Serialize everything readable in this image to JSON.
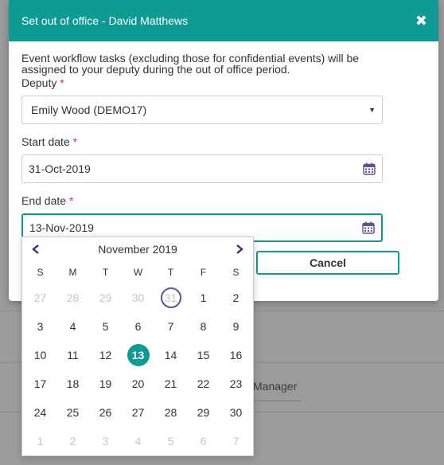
{
  "background": {
    "text": "Manager"
  },
  "modal": {
    "title": "Set out of office - David Matthews",
    "close_glyph": "✖",
    "info": "Event workflow tasks (excluding those for confidential events) will be assigned to your deputy during the out of office period.",
    "deputy": {
      "label": "Deputy",
      "required": "*",
      "value": "Emily Wood (DEMO17)"
    },
    "start": {
      "label": "Start date",
      "required": "*",
      "value": "31-Oct-2019"
    },
    "end": {
      "label": "End date",
      "required": "*",
      "value": "13-Nov-2019"
    },
    "cancel_label": "Cancel"
  },
  "datepicker": {
    "title": "November 2019",
    "dow": [
      "S",
      "M",
      "T",
      "W",
      "T",
      "F",
      "S"
    ],
    "weeks": [
      [
        {
          "d": "27",
          "m": true
        },
        {
          "d": "28",
          "m": true
        },
        {
          "d": "29",
          "m": true
        },
        {
          "d": "30",
          "m": true
        },
        {
          "d": "31",
          "m": true,
          "today": true
        },
        {
          "d": "1"
        },
        {
          "d": "2"
        }
      ],
      [
        {
          "d": "3"
        },
        {
          "d": "4"
        },
        {
          "d": "5"
        },
        {
          "d": "6"
        },
        {
          "d": "7"
        },
        {
          "d": "8"
        },
        {
          "d": "9"
        }
      ],
      [
        {
          "d": "10"
        },
        {
          "d": "11"
        },
        {
          "d": "12"
        },
        {
          "d": "13",
          "selected": true
        },
        {
          "d": "14"
        },
        {
          "d": "15"
        },
        {
          "d": "16"
        }
      ],
      [
        {
          "d": "17"
        },
        {
          "d": "18"
        },
        {
          "d": "19"
        },
        {
          "d": "20"
        },
        {
          "d": "21"
        },
        {
          "d": "22"
        },
        {
          "d": "23"
        }
      ],
      [
        {
          "d": "24"
        },
        {
          "d": "25"
        },
        {
          "d": "26"
        },
        {
          "d": "27"
        },
        {
          "d": "28"
        },
        {
          "d": "29"
        },
        {
          "d": "30"
        }
      ],
      [
        {
          "d": "1",
          "m": true
        },
        {
          "d": "2",
          "m": true
        },
        {
          "d": "3",
          "m": true
        },
        {
          "d": "4",
          "m": true
        },
        {
          "d": "5",
          "m": true
        },
        {
          "d": "6",
          "m": true
        },
        {
          "d": "7",
          "m": true
        }
      ]
    ]
  },
  "colors": {
    "accent": "#0f9a94",
    "required": "#c0306e",
    "today_ring": "#5b4f9e",
    "nav": "#3b2f7a"
  }
}
